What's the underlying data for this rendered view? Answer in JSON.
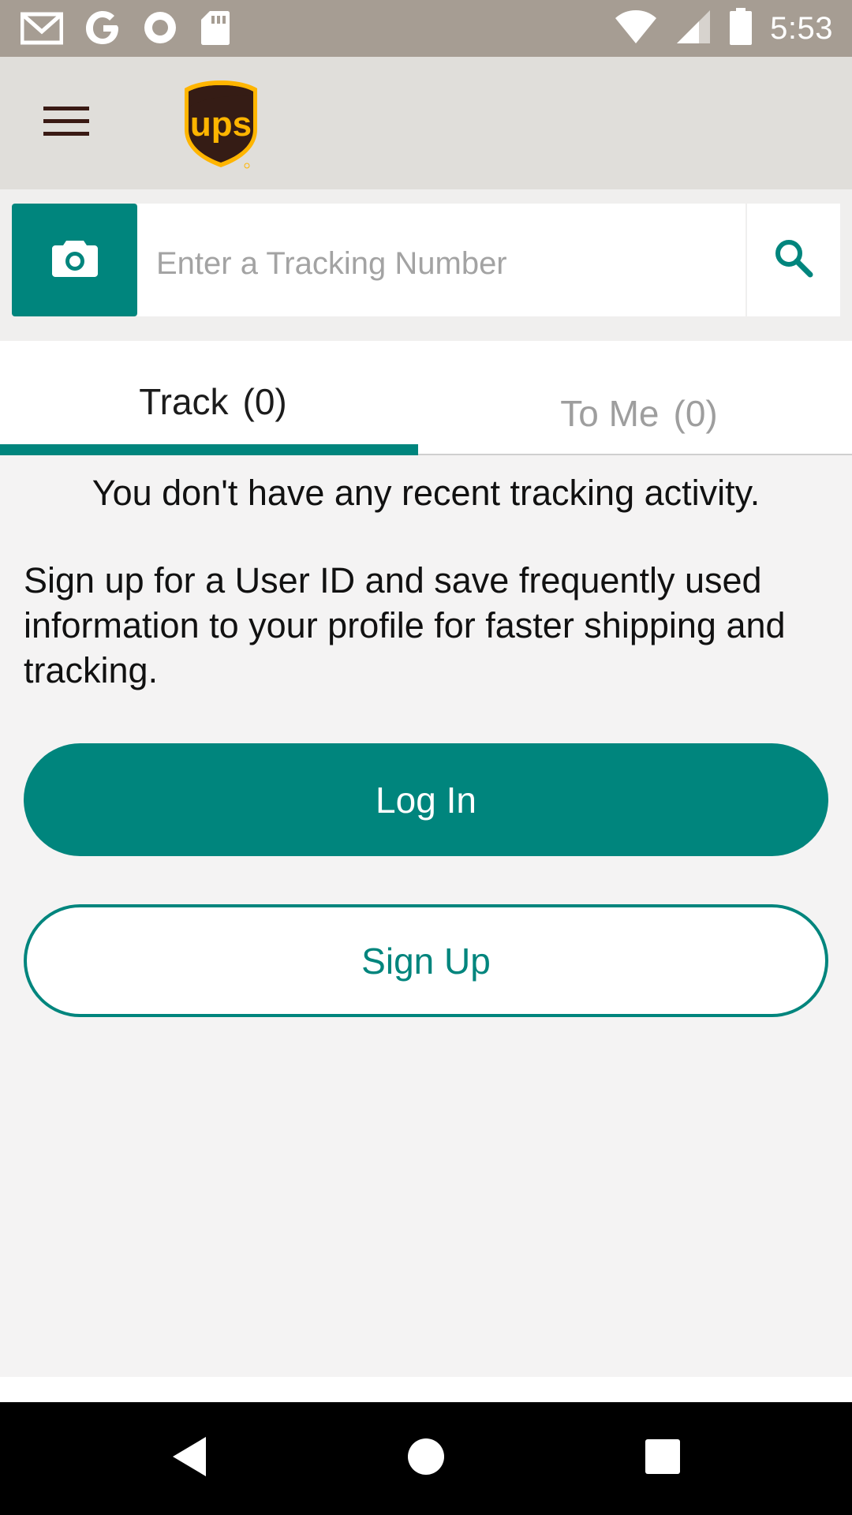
{
  "status_bar": {
    "time": "5:53",
    "left_icons": [
      "gmail-icon",
      "google-icon",
      "record-icon",
      "sd-card-icon"
    ],
    "right_icons": [
      "wifi-icon",
      "signal-icon",
      "battery-icon"
    ]
  },
  "app_bar": {
    "menu_icon": "hamburger-menu-icon",
    "logo_text": "ups"
  },
  "search": {
    "camera_icon": "camera-icon",
    "placeholder": "Enter a Tracking Number",
    "value": "",
    "search_icon": "search-icon"
  },
  "tabs": [
    {
      "label": "Track",
      "count": "(0)",
      "selected": true
    },
    {
      "label": "To Me",
      "count": "(0)",
      "selected": false
    }
  ],
  "content": {
    "empty_message": "You don't have any recent tracking activity.",
    "promo_text": "Sign up for a User ID and save frequently used information to your profile for faster shipping and tracking.",
    "login_label": "Log In",
    "signup_label": "Sign Up"
  },
  "nav_bar": {
    "buttons": [
      "back-icon",
      "home-icon",
      "recents-icon"
    ]
  },
  "colors": {
    "accent": "#00857d",
    "status_bar": "#a69d93",
    "app_bar": "#e0deda",
    "ups_brown": "#351c15",
    "ups_gold": "#ffb500"
  }
}
